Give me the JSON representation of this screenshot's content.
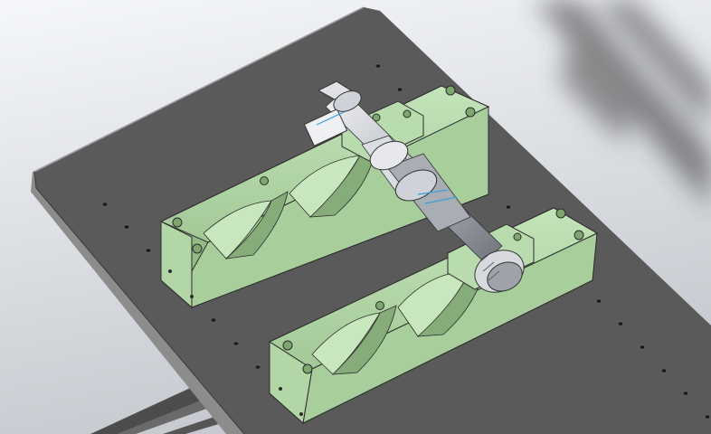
{
  "viewport": {
    "background_top": "#f2f4f8",
    "background_bottom": "#b9bcc2"
  },
  "model": {
    "plate_color": "#5b5b5b",
    "plate_edge_color": "#8a8a8a",
    "saddle_color": "#b9dcae",
    "saddle_shade_color": "#93bb86",
    "shaft_color": "#c9ccd2",
    "motor_color": "#d7d9dd",
    "hole_color": "#1d1d1d",
    "components": [
      "base-plate",
      "upper-saddle-support",
      "lower-saddle-support",
      "drive-shaft-assembly",
      "motor",
      "bearing-block-upper",
      "bearing-block-lower",
      "support-frame"
    ]
  }
}
